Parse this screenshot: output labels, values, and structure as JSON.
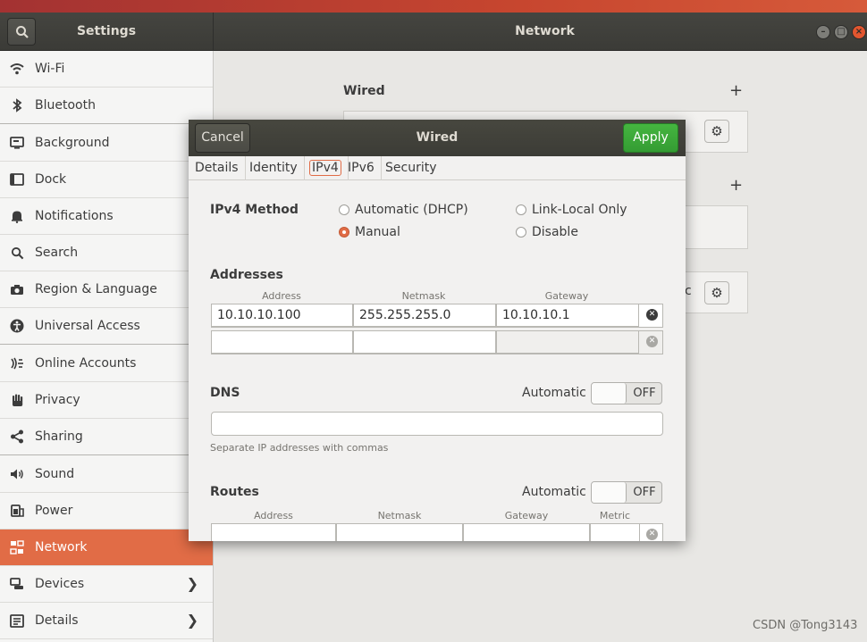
{
  "window": {
    "sidebar_title": "Settings",
    "title": "Network",
    "controls": [
      "minimize-icon",
      "maximize-icon",
      "close-icon"
    ]
  },
  "sidebar": {
    "items": [
      {
        "label": "Wi-Fi",
        "icon": "wifi-icon"
      },
      {
        "label": "Bluetooth",
        "icon": "bluetooth-icon"
      },
      {
        "label": "Background",
        "icon": "background-icon"
      },
      {
        "label": "Dock",
        "icon": "dock-icon"
      },
      {
        "label": "Notifications",
        "icon": "bell-icon"
      },
      {
        "label": "Search",
        "icon": "search-icon"
      },
      {
        "label": "Region & Language",
        "icon": "camera-icon"
      },
      {
        "label": "Universal Access",
        "icon": "accessibility-icon"
      },
      {
        "label": "Online Accounts",
        "icon": "online-accounts-icon"
      },
      {
        "label": "Privacy",
        "icon": "hand-icon"
      },
      {
        "label": "Sharing",
        "icon": "share-icon"
      },
      {
        "label": "Sound",
        "icon": "speaker-icon"
      },
      {
        "label": "Power",
        "icon": "power-icon"
      },
      {
        "label": "Network",
        "icon": "network-icon",
        "active": true
      },
      {
        "label": "Devices",
        "icon": "devices-icon",
        "has_arrow": true
      },
      {
        "label": "Details",
        "icon": "details-icon",
        "has_arrow": true
      }
    ]
  },
  "main": {
    "wired_heading": "Wired",
    "partial_text": "c"
  },
  "dialog": {
    "title": "Wired",
    "cancel_label": "Cancel",
    "apply_label": "Apply",
    "tabs": [
      "Details",
      "Identity",
      "IPv4",
      "IPv6",
      "Security"
    ],
    "active_tab": "IPv4",
    "ipv4_method_label": "IPv4 Method",
    "methods": [
      {
        "label": "Automatic (DHCP)",
        "checked": false
      },
      {
        "label": "Link-Local Only",
        "checked": false
      },
      {
        "label": "Manual",
        "checked": true
      },
      {
        "label": "Disable",
        "checked": false
      }
    ],
    "addresses": {
      "heading": "Addresses",
      "columns": [
        "Address",
        "Netmask",
        "Gateway"
      ],
      "rows": [
        {
          "address": "10.10.10.100",
          "netmask": "255.255.255.0",
          "gateway": "10.10.10.1"
        },
        {
          "address": "",
          "netmask": "",
          "gateway": ""
        }
      ]
    },
    "dns": {
      "heading": "DNS",
      "automatic_label": "Automatic",
      "switch_state": "OFF",
      "value": "",
      "hint": "Separate IP addresses with commas"
    },
    "routes": {
      "heading": "Routes",
      "automatic_label": "Automatic",
      "switch_state": "OFF",
      "columns": [
        "Address",
        "Netmask",
        "Gateway",
        "Metric"
      ]
    }
  },
  "watermark": "CSDN @Tong3143",
  "colors": {
    "accent": "#e16c46",
    "apply": "#3aa936",
    "headerbar": "#3f3f3a"
  }
}
